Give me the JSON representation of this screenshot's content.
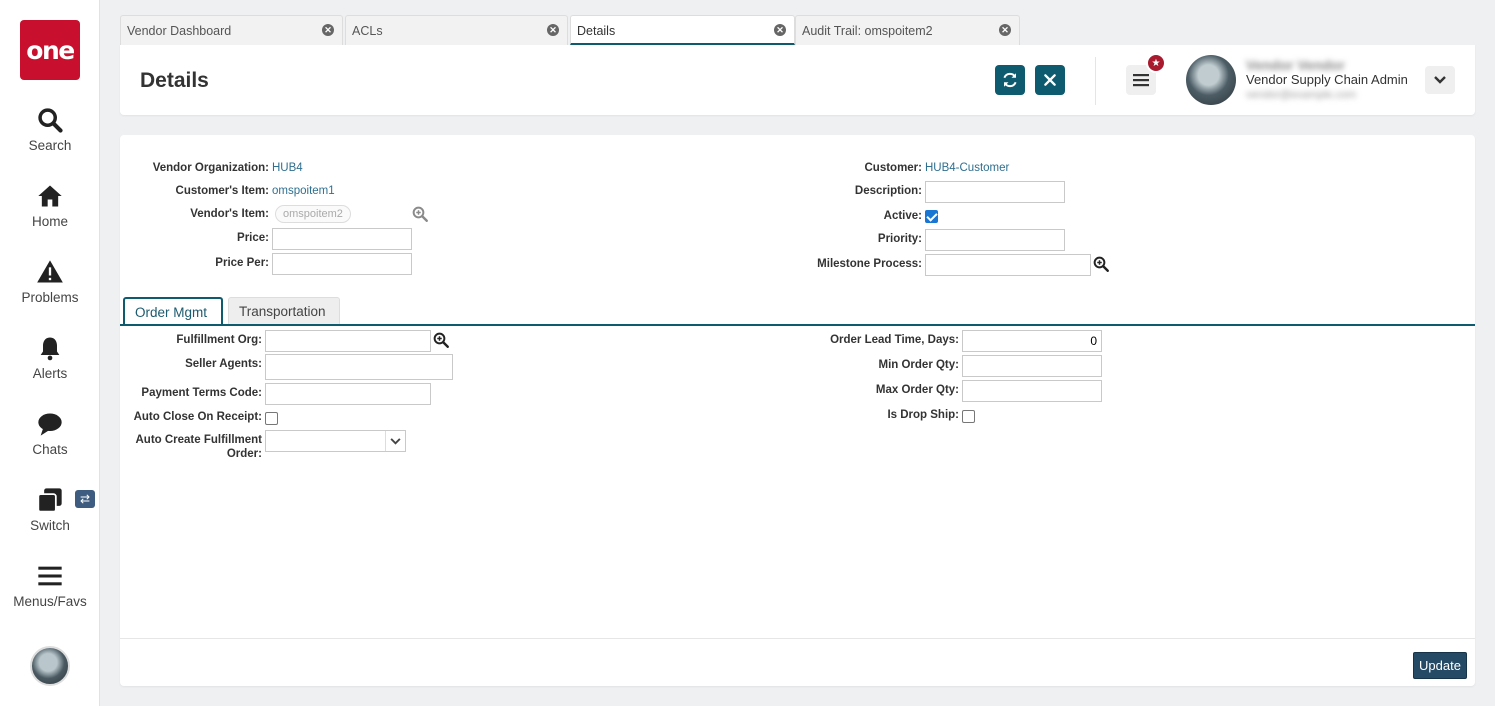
{
  "app": {
    "logo_text": "one"
  },
  "nav": {
    "items": [
      {
        "label": "Search",
        "icon": "search-icon"
      },
      {
        "label": "Home",
        "icon": "home-icon"
      },
      {
        "label": "Problems",
        "icon": "warning-icon"
      },
      {
        "label": "Alerts",
        "icon": "bell-icon"
      },
      {
        "label": "Chats",
        "icon": "chat-icon"
      },
      {
        "label": "Switch",
        "icon": "switch-icon"
      },
      {
        "label": "Menus/Favs",
        "icon": "menu-icon"
      }
    ],
    "switch_badge": "⇄"
  },
  "tabs": [
    {
      "label": "Vendor Dashboard",
      "active": false
    },
    {
      "label": "ACLs",
      "active": false
    },
    {
      "label": "Details",
      "active": true
    },
    {
      "label": "Audit Trail: omspoitem2",
      "active": false
    }
  ],
  "header": {
    "title": "Details",
    "user_name": "Vendor Vendor",
    "user_role": "Vendor Supply Chain Admin",
    "user_email": "vendor@example.com"
  },
  "form": {
    "vendor_org": {
      "label": "Vendor Organization:",
      "value": "HUB4"
    },
    "customers_item": {
      "label": "Customer's Item:",
      "value": "omspoitem1"
    },
    "vendors_item": {
      "label": "Vendor's Item:",
      "value": "omspoitem2"
    },
    "price": {
      "label": "Price:",
      "value": ""
    },
    "price_per": {
      "label": "Price Per:",
      "value": ""
    },
    "customer": {
      "label": "Customer:",
      "value": "HUB4-Customer"
    },
    "description": {
      "label": "Description:",
      "value": ""
    },
    "active": {
      "label": "Active:",
      "checked": true
    },
    "priority": {
      "label": "Priority:",
      "value": ""
    },
    "milestone_process": {
      "label": "Milestone Process:",
      "value": ""
    }
  },
  "subtabs": [
    {
      "label": "Order Mgmt",
      "active": true
    },
    {
      "label": "Transportation",
      "active": false
    }
  ],
  "order_mgmt": {
    "fulfillment_org": {
      "label": "Fulfillment Org:",
      "value": ""
    },
    "seller_agents": {
      "label": "Seller Agents:",
      "value": ""
    },
    "payment_terms": {
      "label": "Payment Terms Code:",
      "value": ""
    },
    "auto_close": {
      "label": "Auto Close On Receipt:",
      "checked": false
    },
    "auto_create_line1": "Auto Create Fulfillment",
    "auto_create_line2": "Order:",
    "auto_create_value": "",
    "lead_time": {
      "label": "Order Lead Time, Days:",
      "value": "0"
    },
    "min_qty": {
      "label": "Min Order Qty:",
      "value": ""
    },
    "max_qty": {
      "label": "Max Order Qty:",
      "value": ""
    },
    "drop_ship": {
      "label": "Is Drop Ship:",
      "checked": false
    }
  },
  "footer": {
    "update_label": "Update"
  },
  "colors": {
    "accent": "#0e5a6e",
    "brand": "#c8102e",
    "link": "#2f6f8f",
    "update": "#244a66"
  }
}
